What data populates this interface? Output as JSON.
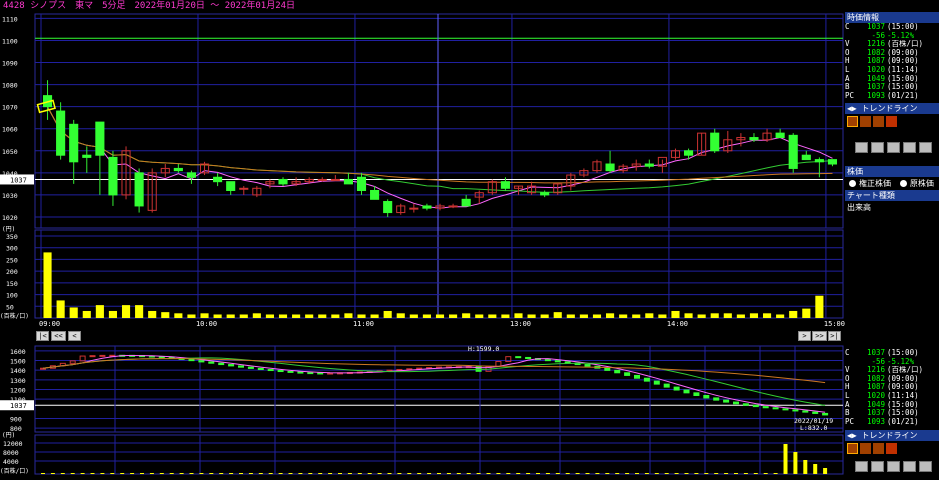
{
  "title": "4428 シノプス　東マ　5分足　2022年01月20日 ～ 2022年01月24日",
  "main_chart": {
    "y_ticks": [
      "1110",
      "1100",
      "1090",
      "1080",
      "1070",
      "1060",
      "1050",
      "1040",
      "1030",
      "1020"
    ],
    "y_values": [
      1110,
      1100,
      1090,
      1080,
      1070,
      1060,
      1050,
      1040,
      1030,
      1020
    ],
    "current_price_label": "1037",
    "time_labels": [
      "09:00",
      "10:00",
      "11:00",
      "13:00",
      "14:00",
      "15:00"
    ],
    "time_index": [
      0,
      12,
      24,
      36,
      48,
      60
    ]
  },
  "volume_chart": {
    "unit_label": "(円)",
    "scale_label": "(百株/口)",
    "y_ticks": [
      "350",
      "300",
      "250",
      "200",
      "150",
      "100",
      "50"
    ],
    "y_values": [
      350,
      300,
      250,
      200,
      150,
      100,
      50
    ]
  },
  "overview_chart": {
    "y_ticks": [
      "1600",
      "1500",
      "1400",
      "1300",
      "1200",
      "1100",
      "1037",
      "900",
      "800"
    ],
    "y_values": [
      1600,
      1500,
      1400,
      1300,
      1200,
      1100,
      1037,
      900,
      800
    ],
    "high_label": "H:1599.0",
    "low_date": "2022/01/19",
    "low_label": "L:832.0",
    "vol_unit_label": "(円)",
    "vol_scale_label": "(百株/口)",
    "vol_y_ticks": [
      "12000",
      "8000",
      "4000"
    ]
  },
  "nav": {
    "first": "|<",
    "prev_fast": "<<",
    "prev": "<",
    "next": ">",
    "next_fast": ">>",
    "last": ">|"
  },
  "sidebar": {
    "quote_header": "時価情報",
    "quote_rows": [
      {
        "k": "C",
        "v1": "1037",
        "v2": "(15:00)"
      },
      {
        "k": "",
        "v1": "-56",
        "v2": "-5.12%"
      },
      {
        "k": "V",
        "v1": "1216",
        "v2": "(百株/口)"
      },
      {
        "k": "O",
        "v1": "1082",
        "v2": "(09:00)"
      },
      {
        "k": "H",
        "v1": "1087",
        "v2": "(09:00)"
      },
      {
        "k": "L",
        "v1": "1020",
        "v2": "(11:14)"
      },
      {
        "k": "A",
        "v1": "1049",
        "v2": "(15:00)"
      },
      {
        "k": "B",
        "v1": "1037",
        "v2": "(15:00)"
      },
      {
        "k": "PC",
        "v1": "1093",
        "v2": "(01/21)"
      }
    ],
    "trendline_label": "トレンドライン",
    "price_header": "株価",
    "adjusted_label": "権正株価",
    "original_label": "原株価",
    "chart_type_header": "チャート種類",
    "chart_type_value": "出来高",
    "quote_header_2": "時価情報",
    "quote_rows_2": [
      {
        "k": "C",
        "v1": "1037",
        "v2": "(15:00)"
      },
      {
        "k": "",
        "v1": "-56",
        "v2": "-5.12%"
      },
      {
        "k": "V",
        "v1": "1216",
        "v2": "(百株/口)"
      },
      {
        "k": "O",
        "v1": "1082",
        "v2": "(09:00)"
      },
      {
        "k": "H",
        "v1": "1087",
        "v2": "(09:00)"
      },
      {
        "k": "L",
        "v1": "1020",
        "v2": "(11:14)"
      },
      {
        "k": "A",
        "v1": "1049",
        "v2": "(15:00)"
      },
      {
        "k": "B",
        "v1": "1037",
        "v2": "(15:00)"
      },
      {
        "k": "PC",
        "v1": "1093",
        "v2": "(01/21)"
      }
    ],
    "trendline_label_2": "トレンドライン"
  },
  "chart_data": {
    "type": "candlestick",
    "candles": [
      [
        1075,
        1082,
        1064,
        1070
      ],
      [
        1068,
        1072,
        1046,
        1048
      ],
      [
        1062,
        1064,
        1035,
        1045
      ],
      [
        1048,
        1052,
        1040,
        1047
      ],
      [
        1063,
        1063,
        1030,
        1048
      ],
      [
        1047,
        1050,
        1025,
        1030
      ],
      [
        1030,
        1052,
        1028,
        1050
      ],
      [
        1040,
        1042,
        1022,
        1025
      ],
      [
        1023,
        1042,
        1022,
        1040
      ],
      [
        1040,
        1044,
        1038,
        1042
      ],
      [
        1042,
        1044,
        1040,
        1041
      ],
      [
        1040,
        1041,
        1035,
        1038
      ],
      [
        1040,
        1045,
        1039,
        1044
      ],
      [
        1038,
        1040,
        1034,
        1036
      ],
      [
        1036,
        1036,
        1030,
        1032
      ],
      [
        1033,
        1034,
        1030,
        1033
      ],
      [
        1030,
        1034,
        1029,
        1033
      ],
      [
        1035,
        1037,
        1033,
        1036
      ],
      [
        1037,
        1038,
        1034,
        1035
      ],
      [
        1035,
        1038,
        1034,
        1036
      ],
      [
        1036,
        1038,
        1035,
        1037
      ],
      [
        1037,
        1038,
        1036,
        1037
      ],
      [
        1037,
        1039,
        1037,
        1037
      ],
      [
        1037,
        1040,
        1035,
        1035
      ],
      [
        1038,
        1040,
        1030,
        1032
      ],
      [
        1032,
        1034,
        1028,
        1028
      ],
      [
        1027,
        1028,
        1020,
        1022
      ],
      [
        1022,
        1026,
        1021,
        1025
      ],
      [
        1024,
        1026,
        1022,
        1024
      ],
      [
        1025,
        1026,
        1023,
        1024
      ],
      [
        1024,
        1026,
        1023,
        1025
      ],
      [
        1025,
        1026,
        1024,
        1025
      ],
      [
        1028,
        1030,
        1025,
        1025
      ],
      [
        1029,
        1032,
        1026,
        1031
      ],
      [
        1031,
        1037,
        1030,
        1036
      ],
      [
        1036,
        1038,
        1032,
        1033
      ],
      [
        1033,
        1034,
        1030,
        1034
      ],
      [
        1031,
        1036,
        1030,
        1034
      ],
      [
        1031,
        1032,
        1029,
        1030
      ],
      [
        1031,
        1035,
        1030,
        1035
      ],
      [
        1034,
        1040,
        1032,
        1039
      ],
      [
        1039,
        1042,
        1038,
        1041
      ],
      [
        1041,
        1046,
        1040,
        1045
      ],
      [
        1044,
        1050,
        1040,
        1041
      ],
      [
        1041,
        1044,
        1040,
        1043
      ],
      [
        1043,
        1046,
        1041,
        1044
      ],
      [
        1044,
        1046,
        1042,
        1043
      ],
      [
        1043,
        1046,
        1040,
        1047
      ],
      [
        1047,
        1051,
        1046,
        1050
      ],
      [
        1050,
        1051,
        1046,
        1048
      ],
      [
        1048,
        1058,
        1048,
        1058
      ],
      [
        1058,
        1060,
        1049,
        1050
      ],
      [
        1050,
        1059,
        1049,
        1055
      ],
      [
        1055,
        1058,
        1052,
        1056
      ],
      [
        1056,
        1058,
        1054,
        1055
      ],
      [
        1055,
        1060,
        1054,
        1058
      ],
      [
        1058,
        1060,
        1056,
        1056
      ],
      [
        1057,
        1058,
        1040,
        1042
      ],
      [
        1048,
        1050,
        1046,
        1046
      ],
      [
        1046,
        1047,
        1038,
        1045
      ],
      [
        1046,
        1046,
        1043,
        1044
      ]
    ],
    "volumes": [
      280,
      75,
      45,
      30,
      55,
      30,
      55,
      55,
      30,
      25,
      20,
      15,
      20,
      15,
      15,
      15,
      20,
      15,
      15,
      15,
      15,
      15,
      15,
      20,
      15,
      15,
      30,
      20,
      15,
      15,
      15,
      15,
      20,
      15,
      15,
      15,
      20,
      15,
      15,
      25,
      15,
      15,
      15,
      20,
      15,
      15,
      20,
      15,
      30,
      20,
      15,
      20,
      20,
      15,
      20,
      20,
      15,
      30,
      40,
      95
    ],
    "ylim": [
      1015,
      1112
    ],
    "vol_ylim": [
      0,
      350
    ]
  }
}
